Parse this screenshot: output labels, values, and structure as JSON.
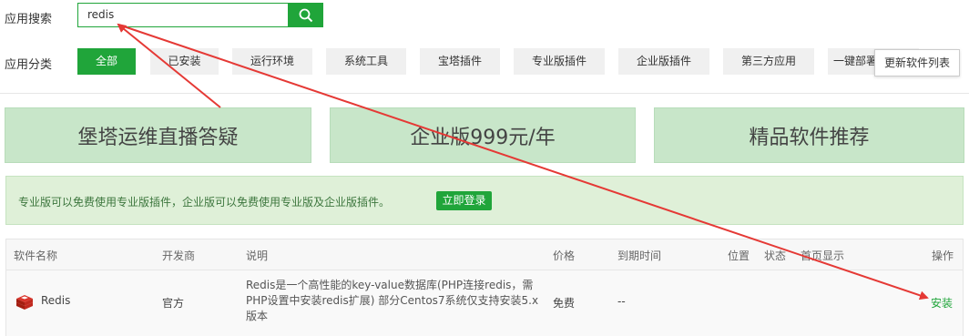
{
  "search": {
    "label": "应用搜索",
    "value": "redis",
    "button_icon": "search-icon"
  },
  "categories": {
    "label": "应用分类",
    "items": [
      "全部",
      "已安装",
      "运行环境",
      "系统工具",
      "宝塔插件",
      "专业版插件",
      "企业版插件",
      "第三方应用",
      "一键部署"
    ],
    "active_index": 0,
    "update_button": "更新软件列表"
  },
  "banners": [
    "堡塔运维直播答疑",
    "企业版999元/年",
    "精品软件推荐"
  ],
  "notice": {
    "text": "专业版可以免费使用专业版插件，企业版可以免费使用专业版及企业版插件。",
    "login_button": "立即登录"
  },
  "table": {
    "headers": [
      "软件名称",
      "开发商",
      "说明",
      "价格",
      "到期时间",
      "位置",
      "状态",
      "首页显示",
      "操作"
    ],
    "rows": [
      {
        "name": "Redis",
        "icon": "redis-icon",
        "developer": "官方",
        "description": "Redis是一个高性能的key-value数据库(PHP连接redis，需PHP设置中安装redis扩展) 部分Centos7系统仅支持安装5.x版本",
        "price": "免费",
        "expiry": "--",
        "action": "安装"
      }
    ]
  },
  "colors": {
    "accent": "#20a53a",
    "annotation_arrow": "#e53935",
    "banner_bg": "#c8e6c9",
    "notice_bg": "#dff0d8"
  }
}
